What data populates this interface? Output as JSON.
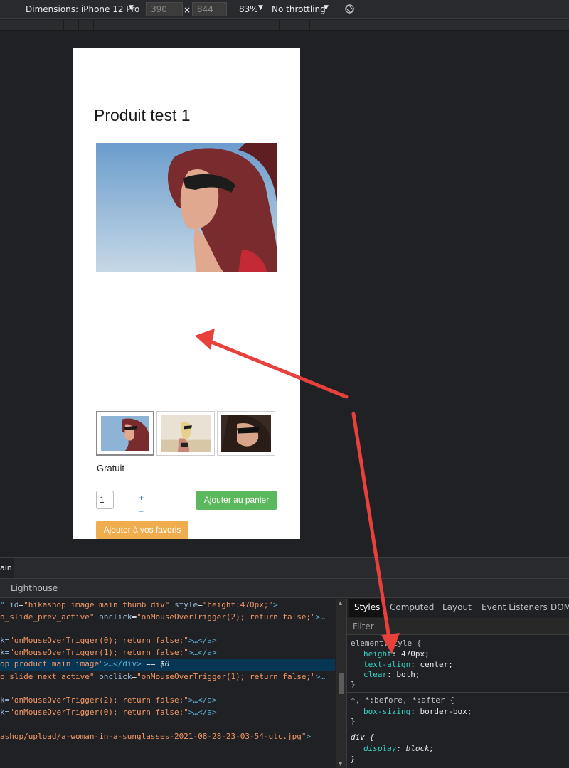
{
  "toolbar": {
    "dimensions_label": "Dimensions: iPhone 12 Pro",
    "width_value": "390",
    "height_value": "844",
    "times": "×",
    "zoom": "83%",
    "throttle": "No throttling"
  },
  "page": {
    "title": "Produit test 1",
    "price": "Gratuit",
    "quantity": "1",
    "plus": "+",
    "minus": "−",
    "add_to_cart": "Ajouter au panier",
    "add_to_favorites": "Ajouter à vos favoris"
  },
  "drawer": {
    "tab": "ain"
  },
  "panel": {
    "tab": "Lighthouse"
  },
  "elements": {
    "lines": [
      {
        "a": "\" ",
        "n": "id",
        "v": "\"hikashop_image_main_thumb_div\"",
        "n2": "style",
        "v2": "\"height:470px;\"",
        "e": ">"
      },
      {
        "a": "o_slide_prev_active\" ",
        "n": "onclick",
        "v": "\"onMouseOverTrigger(2); return false;\"",
        "e": ">…"
      },
      {
        "a": "k=",
        "v": "\"onMouseOverTrigger(0); return false;\"",
        "e": ">…</a>"
      },
      {
        "a": "k=",
        "v": "\"onMouseOverTrigger(1); return false;\"",
        "e": ">…</a>"
      },
      {
        "a": "op_product_main_image\"",
        "e": ">…</div>",
        "d": " == $0"
      },
      {
        "a": "o_slide_next_active\" ",
        "n": "onclick",
        "v": "\"onMouseOverTrigger(1); return false;\"",
        "e": ">…"
      },
      {
        "a": "k=",
        "v": "\"onMouseOverTrigger(2); return false;\"",
        "e": ">…</a>"
      },
      {
        "a": "k=",
        "v": "\"onMouseOverTrigger(0); return false;\"",
        "e": ">…</a>"
      },
      {
        "a": "ashop/upload/a-woman-in-a-sunglasses-2021-08-28-23-03-54-utc.jpg\"",
        "e": ">"
      }
    ]
  },
  "styles": {
    "tabs": [
      "Styles",
      "Computed",
      "Layout",
      "Event Listeners",
      "DOM"
    ],
    "filter_placeholder": "Filter",
    "element_selector": "element.style {",
    "p1": "height",
    "v1": "470px",
    "p2": "text-align",
    "v2": "center",
    "p3": "clear",
    "v3": "both",
    "close": "}",
    "universal_selector": "*, *:before, *:after {",
    "p4": "box-sizing",
    "v4": "border-box",
    "div_selector": "div {",
    "p5": "display",
    "v5": "block"
  },
  "colors": {
    "annotation_arrow": "#e8403b",
    "cart_button": "#5cb85c",
    "favorites_button": "#f0ad4e"
  }
}
